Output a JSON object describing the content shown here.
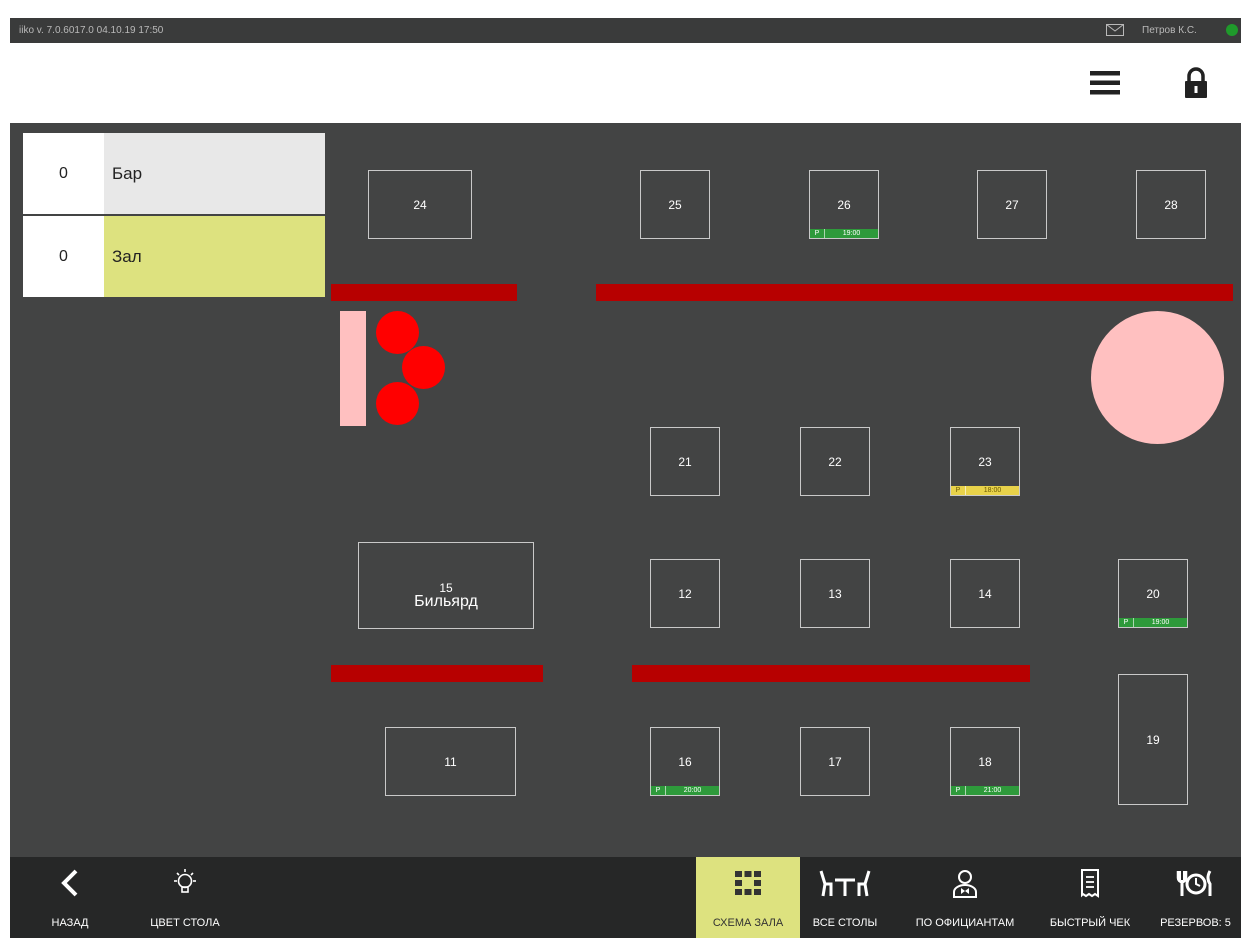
{
  "topbar": {
    "version": "iiko v. 7.0.6017.0   04.10.19  17:50",
    "user": "Петров К.С."
  },
  "sections": [
    {
      "count": "0",
      "name": "Бар",
      "color": "#e8e8e8"
    },
    {
      "count": "0",
      "name": "Зал",
      "color": "#dde27f"
    }
  ],
  "tables": {
    "t24": "24",
    "t25": "25",
    "t26": "26",
    "t27": "27",
    "t28": "28",
    "t21": "21",
    "t22": "22",
    "t23": "23",
    "t15_num": "15",
    "t15_name": "Бильярд",
    "t12": "12",
    "t13": "13",
    "t14": "14",
    "t20": "20",
    "t11": "11",
    "t16": "16",
    "t17": "17",
    "t18": "18",
    "t19": "19"
  },
  "reservations": {
    "r26": {
      "p": "Р",
      "time": "19:00",
      "color": "#2e9a3b"
    },
    "r23": {
      "p": "Р",
      "time": "18:00",
      "color": "#e8d24a"
    },
    "r20": {
      "p": "Р",
      "time": "19:00",
      "color": "#2e9a3b"
    },
    "r16": {
      "p": "Р",
      "time": "20:00",
      "color": "#2e9a3b"
    },
    "r18": {
      "p": "Р",
      "time": "21:00",
      "color": "#2e9a3b"
    }
  },
  "bottom": {
    "back": "НАЗАД",
    "table_color": "ЦВЕТ СТОЛА",
    "hall_scheme": "СХЕМА ЗАЛА",
    "all_tables": "ВСЕ СТОЛЫ",
    "by_waiters": "ПО ОФИЦИАНТАМ",
    "quick_check": "БЫСТРЫЙ ЧЕК",
    "reservations": "РЕЗЕРВОВ: 5"
  },
  "colors": {
    "accent": "#dde27f",
    "wall": "#b70000",
    "reserve_green": "#2e9a3b",
    "reserve_yellow": "#e8d24a",
    "floor": "#434444"
  }
}
